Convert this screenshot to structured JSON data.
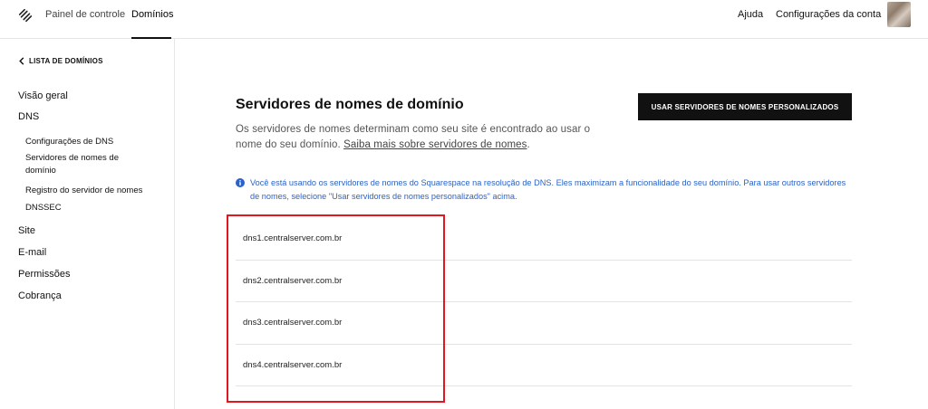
{
  "topbar": {
    "painel": "Painel de controle",
    "dominios": "Domínios",
    "ajuda": "Ajuda",
    "configuracoes": "Configurações da conta"
  },
  "sidebar": {
    "back": "LISTA DE DOMÍNIOS",
    "items": {
      "visao_geral": "Visão geral",
      "dns": "DNS",
      "config_dns": "Configurações de DNS",
      "servidores": "Servidores de nomes de domínio",
      "registro": "Registro do servidor de nomes",
      "dnssec": "DNSSEC",
      "site": "Site",
      "email": "E-mail",
      "permissoes": "Permissões",
      "cobranca": "Cobrança"
    }
  },
  "main": {
    "title": "Servidores de nomes de domínio",
    "description": "Os servidores de nomes determinam como seu site é encontrado ao usar o nome do seu domínio.",
    "learn_more": "Saiba mais sobre servidores de nomes",
    "button": "USAR SERVIDORES DE NOMES PERSONALIZADOS",
    "info": "Você está usando os servidores de nomes do Squarespace na resolução de DNS. Eles maximizam a funcionalidade do seu domínio. Para usar outros servidores de nomes, selecione \"Usar servidores de nomes personalizados\" acima.",
    "nameservers": [
      "dns1.centralserver.com.br",
      "dns2.centralserver.com.br",
      "dns3.centralserver.com.br",
      "dns4.centralserver.com.br"
    ]
  },
  "colors": {
    "accent_info": "#2a62c9",
    "button_bg": "#111111",
    "highlight": "#e0171f"
  }
}
